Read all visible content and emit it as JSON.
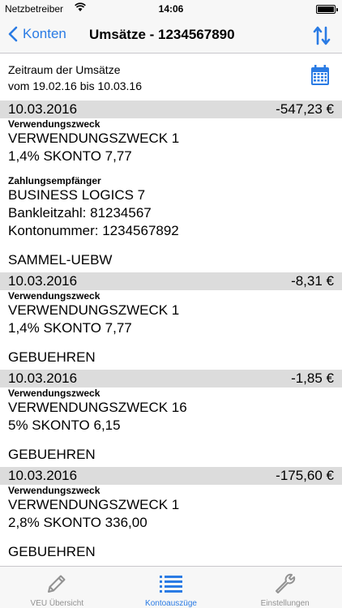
{
  "status_bar": {
    "carrier": "Netzbetreiber",
    "time": "14:06"
  },
  "nav": {
    "back_label": "Konten",
    "title": "Umsätze - 1234567890"
  },
  "period": {
    "label": "Zeitraum der Umsätze",
    "range": "vom 19.02.16 bis 10.03.16"
  },
  "labels": {
    "purpose": "Verwendungszweck",
    "recipient": "Zahlungsempfänger"
  },
  "transactions": [
    {
      "date": "10.03.2016",
      "amount": "-547,23 €",
      "purpose_lines": [
        "VERWENDUNGSZWECK 1",
        "1,4% SKONTO 7,77"
      ],
      "recipient_lines": [
        "BUSINESS LOGICS 7",
        "Bankleitzahl: 81234567",
        "Kontonummer: 1234567892"
      ],
      "type": "SAMMEL-UEBW"
    },
    {
      "date": "10.03.2016",
      "amount": "-8,31 €",
      "purpose_lines": [
        "VERWENDUNGSZWECK 1",
        "1,4% SKONTO 7,77"
      ],
      "type": "GEBUEHREN"
    },
    {
      "date": "10.03.2016",
      "amount": "-1,85 €",
      "purpose_lines": [
        "VERWENDUNGSZWECK 16",
        "5% SKONTO 6,15"
      ],
      "type": "GEBUEHREN"
    },
    {
      "date": "10.03.2016",
      "amount": "-175,60 €",
      "purpose_lines": [
        "VERWENDUNGSZWECK 1",
        "2,8% SKONTO 336,00"
      ],
      "type": "GEBUEHREN"
    }
  ],
  "tabs": [
    {
      "label": "VEU Übersicht",
      "icon": "pencil-icon"
    },
    {
      "label": "Kontoauszüge",
      "icon": "list-icon",
      "active": true
    },
    {
      "label": "Einstellungen",
      "icon": "wrench-icon"
    }
  ],
  "colors": {
    "accent": "#2a7be4",
    "inactive": "#929292",
    "row_header": "#dcdcdc"
  }
}
